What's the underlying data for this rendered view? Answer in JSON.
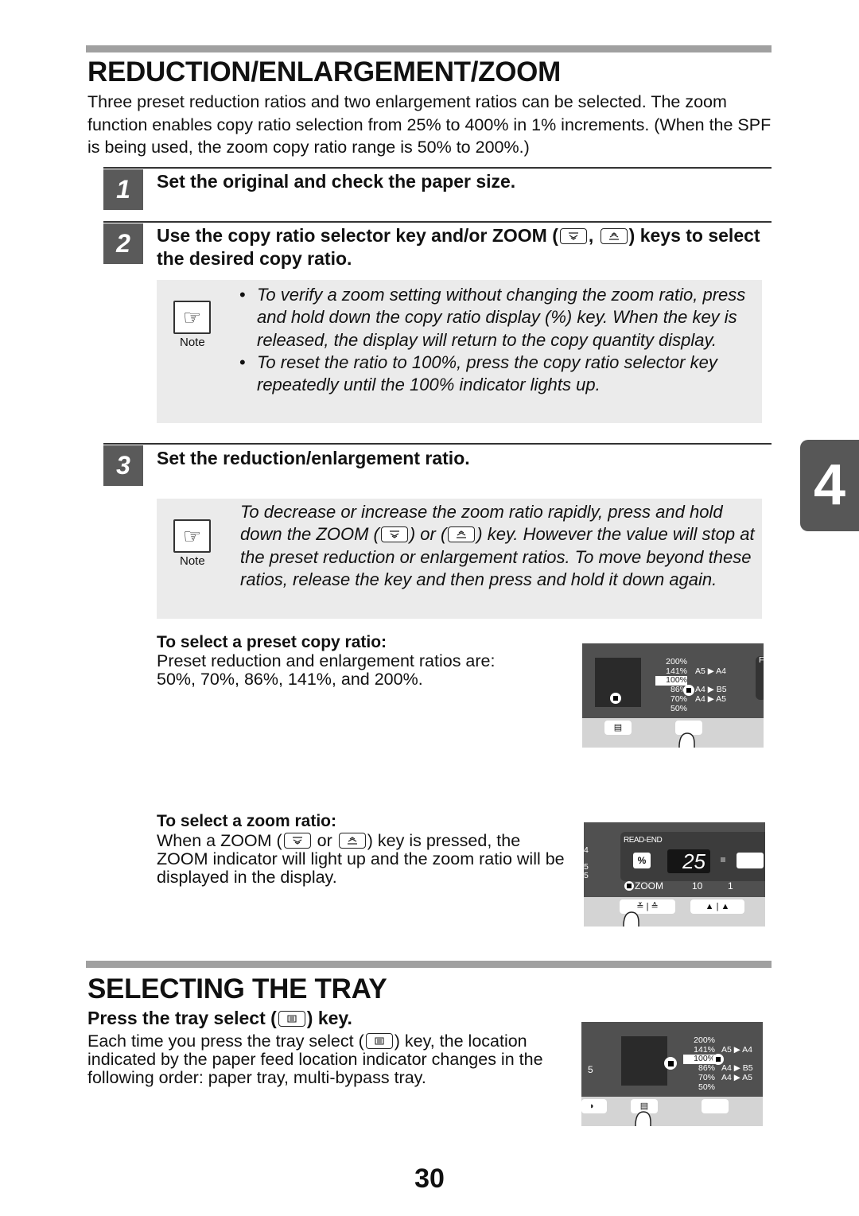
{
  "section1": {
    "title": "REDUCTION/ENLARGEMENT/ZOOM",
    "intro": "Three preset reduction ratios and two enlargement ratios can be selected. The zoom function enables copy ratio selection from 25% to 400% in 1% increments. (When the SPF is being used, the zoom copy ratio range is 50% to 200%.)",
    "steps": [
      {
        "num": "1",
        "text": "Set the original and check the paper size."
      },
      {
        "num": "2",
        "text_a": "Use the copy ratio selector key and/or ZOOM (",
        "text_b": ",",
        "text_c": ") keys to select the desired copy ratio."
      },
      {
        "num": "3",
        "text": "Set the reduction/enlargement ratio."
      }
    ],
    "note1": {
      "label": "Note",
      "bullets": [
        "To verify a zoom setting without changing the zoom ratio, press and hold down the copy ratio display (%) key. When the key is released, the display will return to the copy quantity display.",
        "To reset the ratio to 100%, press the copy ratio selector key repeatedly until the 100% indicator lights up."
      ]
    },
    "note2": {
      "label": "Note",
      "text_a": "To decrease or increase the zoom ratio rapidly, press and hold down the ZOOM (",
      "text_b": ") or (",
      "text_c": ") key. However the value will stop at the preset reduction or enlargement ratios. To move beyond these ratios, release the key and then press and hold it down again."
    },
    "preset": {
      "heading": "To select a preset copy ratio:",
      "text": "Preset reduction and enlargement ratios are: 50%, 70%, 86%, 141%, and 200%."
    },
    "zoom": {
      "heading": "To select a zoom ratio:",
      "text_a": "When a ZOOM (",
      "text_b": " or ",
      "text_c": ") key is pressed, the ZOOM indicator will light up and the zoom ratio will be displayed in the display."
    }
  },
  "panel_ratio": {
    "ratios": [
      "200%",
      "141%",
      "100%",
      "86%",
      "70%",
      "50%"
    ],
    "paper": [
      "A5 ▶ A4",
      "A4 ▶ B5",
      "A4 ▶ A5"
    ],
    "cut_letter": "F"
  },
  "panel_zoom": {
    "read_end": "READ-END",
    "percent_key": "%",
    "display": "25",
    "zoom_label": "ZOOM",
    "count_a": "10",
    "count_b": "1",
    "side_digits": [
      "4",
      "5",
      "5"
    ]
  },
  "panel_tray": {
    "side_digit": "5"
  },
  "section2": {
    "title": "SELECTING THE TRAY",
    "subheading_a": "Press the tray select (",
    "subheading_b": ") key.",
    "text_a": "Each time you press the tray select (",
    "text_b": ") key, the location indicated by the paper feed location indicator changes in the following order: paper tray, multi-bypass tray."
  },
  "chapter_tab": "4",
  "page_number": "30",
  "icons": {
    "zoom_down": "zoom-down-key-icon",
    "zoom_up": "zoom-up-key-icon",
    "tray": "tray-select-key-icon",
    "note": "pointing-hand-icon"
  }
}
